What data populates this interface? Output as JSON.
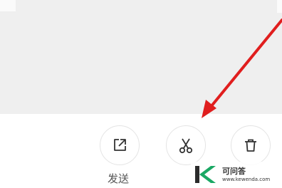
{
  "actions": [
    {
      "name": "send",
      "icon": "share-out-icon",
      "label": "发送"
    },
    {
      "name": "cut",
      "icon": "scissors-icon",
      "label": ""
    },
    {
      "name": "delete",
      "icon": "trash-icon",
      "label": ""
    }
  ],
  "watermark": {
    "site_name": "可问答",
    "site_url": "www.kewenda.com",
    "logo_letter": "K"
  },
  "colors": {
    "arrow": "#e01e1e",
    "icon_stroke": "#333333",
    "logo_green": "#1aa864",
    "logo_dark": "#2b2b2b",
    "top_area": "#efefef"
  }
}
